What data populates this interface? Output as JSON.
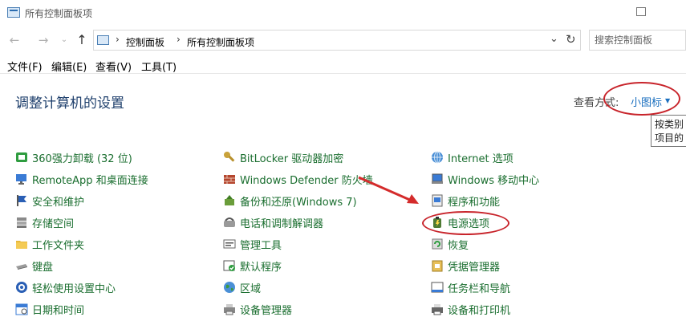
{
  "window": {
    "title": "所有控制面板项"
  },
  "nav": {
    "back_icon": "arrow-left-icon",
    "forward_icon": "arrow-right-icon",
    "recent_icon": "chevron-down-icon",
    "up_icon": "arrow-up-icon",
    "breadcrumb": [
      "控制面板",
      "所有控制面板项"
    ],
    "refresh_icon": "refresh-icon",
    "search_placeholder": "搜索控制面板"
  },
  "menu": [
    "文件(F)",
    "编辑(E)",
    "查看(V)",
    "工具(T)"
  ],
  "main": {
    "heading": "调整计算机的设置",
    "view_by_label": "查看方式:",
    "view_by_value": "小图标",
    "tooltip_lines": [
      "按类别",
      "项目的"
    ]
  },
  "columns": [
    [
      {
        "label": "360强力卸载 (32 位)",
        "icon": "uninstall-icon"
      },
      {
        "label": "RemoteApp 和桌面连接",
        "icon": "remote-desktop-icon"
      },
      {
        "label": "安全和维护",
        "icon": "flag-icon"
      },
      {
        "label": "存储空间",
        "icon": "storage-icon"
      },
      {
        "label": "工作文件夹",
        "icon": "folder-icon"
      },
      {
        "label": "键盘",
        "icon": "keyboard-icon"
      },
      {
        "label": "轻松使用设置中心",
        "icon": "accessibility-icon"
      },
      {
        "label": "日期和时间",
        "icon": "calendar-icon"
      }
    ],
    [
      {
        "label": "BitLocker 驱动器加密",
        "icon": "key-icon"
      },
      {
        "label": "Windows Defender 防火墙",
        "icon": "firewall-icon"
      },
      {
        "label": "备份和还原(Windows 7)",
        "icon": "backup-icon"
      },
      {
        "label": "电话和调制解调器",
        "icon": "phone-icon"
      },
      {
        "label": "管理工具",
        "icon": "tools-icon"
      },
      {
        "label": "默认程序",
        "icon": "check-icon"
      },
      {
        "label": "区域",
        "icon": "globe-icon"
      },
      {
        "label": "设备管理器",
        "icon": "printer-device-icon"
      }
    ],
    [
      {
        "label": "Internet 选项",
        "icon": "internet-icon"
      },
      {
        "label": "Windows 移动中心",
        "icon": "mobility-icon"
      },
      {
        "label": "程序和功能",
        "icon": "programs-icon"
      },
      {
        "label": "电源选项",
        "icon": "power-icon"
      },
      {
        "label": "恢复",
        "icon": "recovery-icon"
      },
      {
        "label": "凭据管理器",
        "icon": "credential-icon"
      },
      {
        "label": "任务栏和导航",
        "icon": "taskbar-icon"
      },
      {
        "label": "设备和打印机",
        "icon": "printer-icon"
      }
    ]
  ],
  "colors": {
    "link": "#1a6e2f",
    "heading": "#1e3f6c",
    "accent": "#1a6fbf",
    "annotation": "#c8242b"
  }
}
